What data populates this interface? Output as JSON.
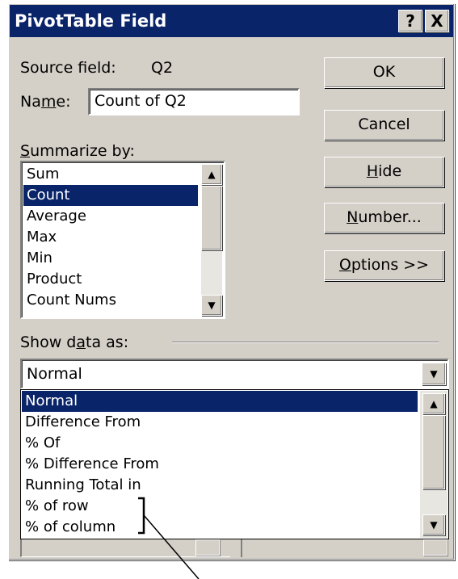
{
  "window": {
    "title": "PivotTable Field",
    "help_button": "?",
    "close_button": "X"
  },
  "source_field": {
    "label": "Source field:",
    "value": "Q2"
  },
  "name_field": {
    "label_pre": "Na",
    "label_ul": "m",
    "label_post": "e:",
    "value": "Count of Q2"
  },
  "summarize": {
    "label_ul": "S",
    "label_rest": "ummarize by:",
    "items": [
      "Sum",
      "Count",
      "Average",
      "Max",
      "Min",
      "Product",
      "Count Nums"
    ],
    "selected": "Count"
  },
  "buttons": {
    "ok": "OK",
    "cancel": "Cancel",
    "hide_ul": "H",
    "hide_rest": "ide",
    "number_ul": "N",
    "number_rest": "umber...",
    "options_ul": "O",
    "options_rest": "ptions >>"
  },
  "show_data_as": {
    "label_pre": "Show d",
    "label_ul": "a",
    "label_post": "ta as:",
    "value": "Normal",
    "options": [
      "Normal",
      "Difference From",
      "% Of",
      "% Difference From",
      "Running Total in",
      "% of row",
      "% of column"
    ],
    "selected": "Normal"
  },
  "colors": {
    "titlebar": "#0a246a",
    "face": "#d4d0c8",
    "selection": "#0a246a"
  },
  "icons": {
    "scroll_up": "▲",
    "scroll_down": "▼",
    "dropdown": "▼"
  }
}
